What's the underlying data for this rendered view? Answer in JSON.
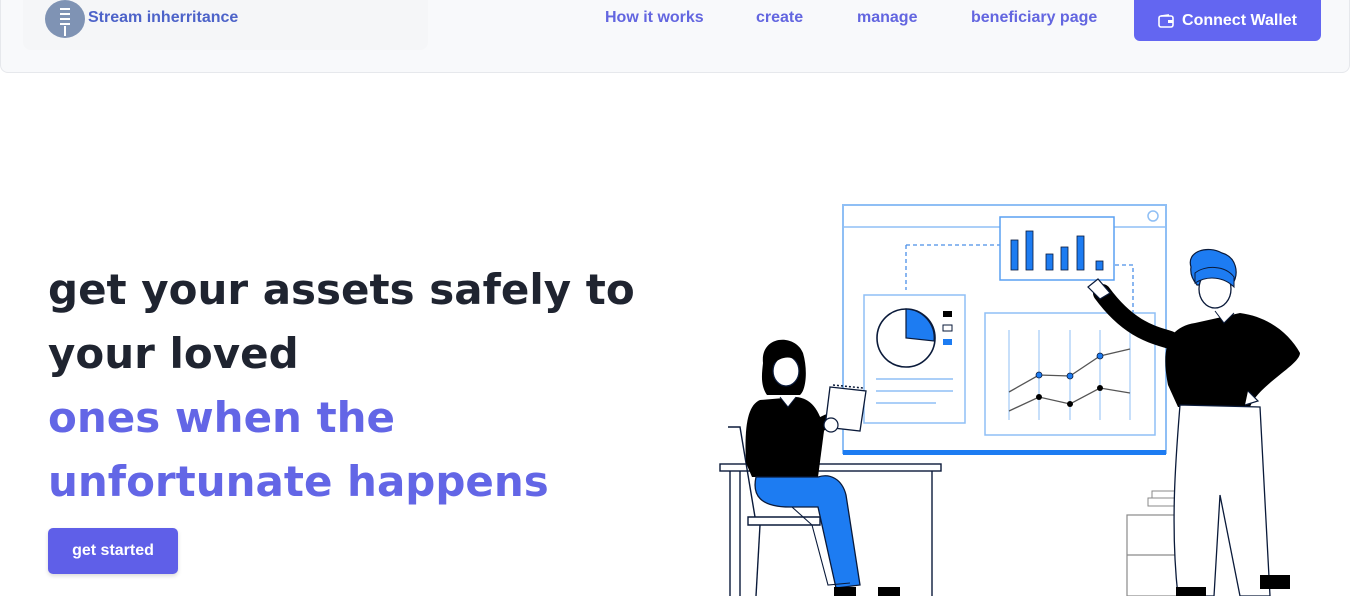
{
  "brand": {
    "name": "Stream inherritance",
    "logo_icon": "tower-logo-icon"
  },
  "nav": {
    "links": [
      "How it works",
      "create",
      "manage",
      "beneficiary page"
    ],
    "connect_label": "Connect Wallet",
    "connect_icon": "wallet-icon"
  },
  "hero": {
    "line1": "get your assets safely to",
    "line2": "your loved",
    "line3": "ones when the",
    "line4": "unfortunate happens",
    "cta_label": "get started"
  },
  "colors": {
    "accent": "#6366f1",
    "headline_dark": "#1f2430",
    "headline_accent": "#6366e6",
    "illustration_blue": "#1d7cf2"
  },
  "illustration": {
    "name": "people-analyzing-dashboard-illustration"
  }
}
